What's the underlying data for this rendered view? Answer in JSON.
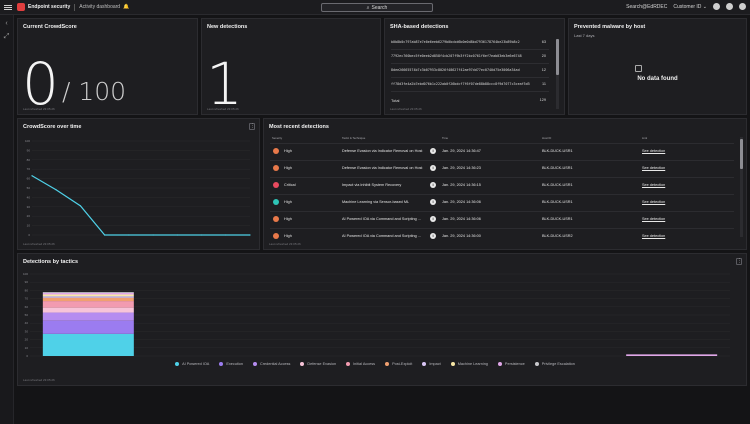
{
  "topbar": {
    "app_title": "Endpoint security",
    "breadcrumb": "Activity dashboard",
    "search_label": "Search",
    "shortcut_label": "Search@EdRDEC",
    "customer_label": "Customer ID ⌄"
  },
  "crowdscore": {
    "title": "Current CrowdScore",
    "value": "0",
    "max": "/ 100",
    "refreshed": "Last refreshed 23:05:26"
  },
  "new_detections": {
    "title": "New detections",
    "value": "1",
    "refreshed": "Last refreshed 23:05:26"
  },
  "sha": {
    "title": "SHA-based detections",
    "rows": [
      {
        "hash": "b0b8b0c797ab87e7e0e6eeb6279b0bcbd6b0e0d8bd7936178764be23b89b8c2",
        "count": "63"
      },
      {
        "hash": "7792ec760bec5fe0eeb2d858f4cb207f9b3ff2bc0761f6ef7eab03eb3e6e6748",
        "count": "20"
      },
      {
        "hash": "8dee26665574b7c3b07953c8026f48627f42ae97dd77ec0740d75e3006a34ad",
        "count": "12"
      },
      {
        "hash": "ff78d3fe4a2b7ebd076b1c222ab0f26bdcf7f6f07de88b88ccc8f9d7077c3ceaf5d5",
        "count": "11"
      }
    ],
    "total_label": "Total",
    "total_value": "129",
    "refreshed": "Last refreshed 23:05:26"
  },
  "malware": {
    "title": "Prevented malware by host",
    "subtitle": "Last 7 days",
    "empty": "No data found"
  },
  "crowdscore_time": {
    "title": "CrowdScore over time",
    "refreshed": "Last refreshed 23:05:26"
  },
  "recent": {
    "title": "Most recent detections",
    "headers": [
      "Severity",
      "Tactic & Technique",
      "Time",
      "Host ID",
      "Link"
    ],
    "rows": [
      {
        "severity": "High",
        "tactic": "Defense Evasion via Indicator Removal on Host",
        "time": "Jan. 29, 2024 14:36:47",
        "host": "BLK-DUCK-USR1",
        "link": "See detection",
        "color": "#e8794a"
      },
      {
        "severity": "High",
        "tactic": "Defense Evasion via Indicator Removal on Host",
        "time": "Jan. 29, 2024 14:36:23",
        "host": "BLK-DUCK-USR1",
        "link": "See detection",
        "color": "#e8794a"
      },
      {
        "severity": "Critical",
        "tactic": "Impact via Inhibit System Recovery",
        "time": "Jan. 29, 2024 14:36:15",
        "host": "BLK-DUCK-USR1",
        "link": "See detection",
        "color": "#e84a5f"
      },
      {
        "severity": "High",
        "tactic": "Machine Learning via Sensor-based ML",
        "time": "Jan. 29, 2024 14:36:06",
        "host": "BLK-DUCK-USR1",
        "link": "See detection",
        "color": "#2ec4b6"
      },
      {
        "severity": "High",
        "tactic": "AI Powered IOA via Command and Scripting ...",
        "time": "Jan. 29, 2024 14:36:06",
        "host": "BLK-DUCK-USR1",
        "link": "See detection",
        "color": "#e8794a"
      },
      {
        "severity": "High",
        "tactic": "AI Powered IOA via Command and Scripting ...",
        "time": "Jan. 29, 2024 14:36:00",
        "host": "BLK-DUCK-USR2",
        "link": "See detection",
        "color": "#e8794a"
      }
    ],
    "refreshed": "Last refreshed 23:05:26"
  },
  "tactics": {
    "title": "Detections by tactics",
    "refreshed": "Last refreshed 23:05:26",
    "legend": [
      {
        "label": "AI Powered IOA",
        "color": "#4fd1e8"
      },
      {
        "label": "Execution",
        "color": "#9b7cf0"
      },
      {
        "label": "Credential Access",
        "color": "#b58cf0"
      },
      {
        "label": "Defense Evasion",
        "color": "#f7c4d8"
      },
      {
        "label": "Initial Access",
        "color": "#f29bb0"
      },
      {
        "label": "Post-Exploit",
        "color": "#f0a070"
      },
      {
        "label": "Impact",
        "color": "#d9c6f5"
      },
      {
        "label": "Machine Learning",
        "color": "#f7e7a6"
      },
      {
        "label": "Persistence",
        "color": "#e0a7e8"
      },
      {
        "label": "Privilege Escalation",
        "color": "#c8c8cc"
      }
    ]
  },
  "chart_data": [
    {
      "type": "line",
      "title": "CrowdScore over time",
      "ylim": [
        0,
        100
      ],
      "yticks": [
        "0",
        "10",
        "20",
        "30",
        "40",
        "50",
        "60",
        "70",
        "80",
        "90",
        "100"
      ],
      "series": [
        {
          "values": [
            63,
            48,
            31,
            0,
            0,
            0,
            0,
            0,
            0,
            0
          ]
        }
      ],
      "line_color": "#4fd1e8"
    },
    {
      "type": "bar",
      "title": "Detections by tactics",
      "ylim": [
        0,
        100
      ],
      "yticks": [
        "0",
        "10",
        "20",
        "30",
        "40",
        "50",
        "60",
        "70",
        "80",
        "90",
        "100"
      ],
      "stack_order": [
        "AI Powered IOA",
        "Execution",
        "Credential Access",
        "Defense Evasion",
        "Initial Access",
        "Post-Exploit",
        "Impact",
        "Machine Learning",
        "Persistence",
        "Privilege Escalation"
      ],
      "groups": [
        {
          "values": [
            27,
            16,
            10,
            6,
            8,
            4,
            2,
            2,
            2,
            1
          ]
        },
        {
          "values": [
            0,
            0,
            0,
            0,
            0,
            0,
            0,
            0,
            0,
            0
          ]
        },
        {
          "values": [
            0,
            0,
            0,
            0,
            0,
            0,
            0,
            0,
            0,
            0
          ]
        },
        {
          "values": [
            0,
            0,
            0,
            0,
            0,
            0,
            0,
            0,
            0,
            0
          ]
        },
        {
          "values": [
            0,
            0,
            0,
            0,
            0,
            0,
            0,
            0,
            0,
            0
          ]
        },
        {
          "values": [
            0,
            0,
            0,
            0,
            0,
            0,
            0,
            0,
            2,
            0
          ]
        }
      ]
    }
  ]
}
